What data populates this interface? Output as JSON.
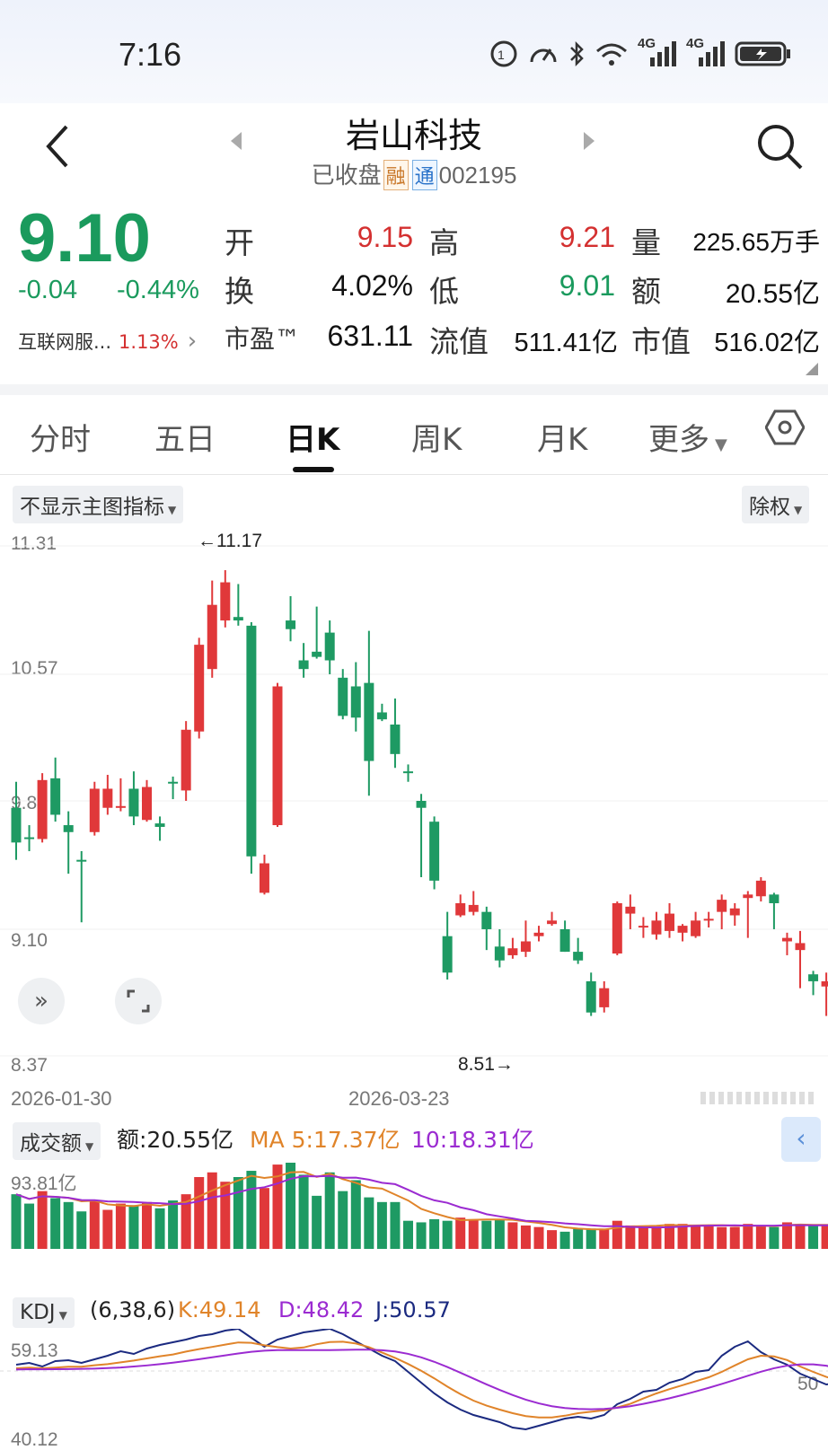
{
  "status_bar": {
    "time": "7:16",
    "icons": [
      "notification-icon",
      "speed-icon",
      "bluetooth-icon",
      "wifi-icon",
      "signal-4g-icon",
      "signal-4g-icon",
      "battery-icon"
    ],
    "net1": "4G",
    "net2": "4G"
  },
  "header": {
    "title": "岩山科技",
    "status": "已收盘",
    "badge1": "融",
    "badge2": "通",
    "code": "002195"
  },
  "quote": {
    "price": "9.10",
    "change": "-0.04",
    "change_pct": "-0.44%",
    "sector_name": "互联网服...",
    "sector_pct": "1.13%",
    "open_label": "开",
    "open": "9.15",
    "high_label": "高",
    "high": "9.21",
    "volume_label": "量",
    "volume": "225.65万手",
    "turnover_label": "换",
    "turnover": "4.02%",
    "low_label": "低",
    "low": "9.01",
    "amount_label": "额",
    "amount": "20.55亿",
    "pe_label": "市盈™",
    "pe": "631.11",
    "float_label": "流值",
    "float_cap": "511.41亿",
    "mcap_label": "市值",
    "mcap": "516.02亿"
  },
  "tabs": [
    "分时",
    "五日",
    "日K",
    "周K",
    "月K",
    "更多"
  ],
  "active_tab": "日K",
  "chart": {
    "indicator_label": "不显示主图指标",
    "adjust_label": "除权",
    "y_labels": [
      "11.31",
      "10.57",
      "9.84",
      "9.10",
      "8.37"
    ],
    "max_marker": "←11.17",
    "min_marker": "8.51→",
    "date_start": "2026-01-30",
    "date_mid": "2026-03-23",
    "up_color": "#e0383a",
    "down_color": "#1e9a63"
  },
  "volume": {
    "label": "成交额",
    "amount": "额:20.55亿",
    "ma5": "MA 5:17.37亿",
    "ma10": "10:18.31亿",
    "max_label": "93.81亿"
  },
  "kdj": {
    "label": "KDJ",
    "params": "(6,38,6)",
    "k": "K:49.14",
    "d": "D:48.42",
    "j": "J:50.57",
    "top": "59.13",
    "bottom": "40.12",
    "right": "50"
  },
  "chart_data": {
    "type": "candlestick",
    "x_range": [
      "2026-01-30",
      "2026-05-?"
    ],
    "ylim": [
      8.37,
      11.31
    ],
    "candles": [
      [
        9.8,
        9.6,
        9.95,
        9.5
      ],
      [
        9.63,
        9.62,
        9.7,
        9.55
      ],
      [
        9.62,
        9.96,
        10.0,
        9.6
      ],
      [
        9.97,
        9.76,
        10.09,
        9.72
      ],
      [
        9.7,
        9.66,
        9.78,
        9.42
      ],
      [
        9.5,
        9.49,
        9.55,
        9.14
      ],
      [
        9.66,
        9.91,
        9.95,
        9.64
      ],
      [
        9.8,
        9.91,
        9.99,
        9.76
      ],
      [
        9.8,
        9.81,
        9.97,
        9.78
      ],
      [
        9.91,
        9.75,
        10.01,
        9.7
      ],
      [
        9.73,
        9.92,
        9.96,
        9.72
      ],
      [
        9.71,
        9.69,
        9.75,
        9.61
      ],
      [
        9.95,
        9.94,
        9.98,
        9.85
      ],
      [
        9.9,
        10.25,
        10.3,
        9.84
      ],
      [
        10.24,
        10.74,
        10.78,
        10.2
      ],
      [
        10.6,
        10.97,
        11.11,
        10.55
      ],
      [
        10.88,
        11.1,
        11.17,
        10.84
      ],
      [
        10.9,
        10.88,
        11.09,
        10.85
      ],
      [
        10.85,
        9.52,
        10.87,
        9.42
      ],
      [
        9.31,
        9.48,
        9.53,
        9.3
      ],
      [
        9.7,
        10.5,
        10.52,
        9.69
      ],
      [
        10.88,
        10.83,
        11.02,
        10.76
      ],
      [
        10.65,
        10.6,
        10.75,
        10.55
      ],
      [
        10.7,
        10.67,
        10.96,
        10.66
      ],
      [
        10.81,
        10.65,
        10.88,
        10.57
      ],
      [
        10.55,
        10.33,
        10.6,
        10.31
      ],
      [
        10.5,
        10.32,
        10.64,
        10.24
      ],
      [
        10.52,
        10.07,
        10.82,
        9.87
      ],
      [
        10.35,
        10.31,
        10.4,
        10.3
      ],
      [
        10.28,
        10.11,
        10.43,
        10.03
      ],
      [
        10.01,
        10.0,
        10.05,
        9.95
      ],
      [
        9.84,
        9.8,
        9.88,
        9.4
      ],
      [
        9.72,
        9.38,
        9.75,
        9.33
      ],
      [
        9.06,
        8.85,
        9.2,
        8.81
      ],
      [
        9.18,
        9.25,
        9.3,
        9.17
      ],
      [
        9.2,
        9.24,
        9.32,
        9.18
      ],
      [
        9.2,
        9.1,
        9.23,
        8.98
      ],
      [
        9.0,
        8.92,
        9.1,
        8.88
      ],
      [
        8.95,
        8.99,
        9.05,
        8.93
      ],
      [
        8.97,
        9.03,
        9.15,
        8.94
      ],
      [
        9.06,
        9.08,
        9.12,
        9.03
      ],
      [
        9.13,
        9.15,
        9.2,
        9.12
      ],
      [
        9.1,
        8.97,
        9.15,
        8.97
      ],
      [
        8.97,
        8.92,
        9.05,
        8.9
      ],
      [
        8.8,
        8.62,
        8.85,
        8.6
      ],
      [
        8.65,
        8.76,
        8.8,
        8.62
      ],
      [
        8.96,
        9.25,
        9.26,
        8.95
      ],
      [
        9.19,
        9.23,
        9.3,
        9.1
      ],
      [
        9.11,
        9.12,
        9.17,
        9.05
      ],
      [
        9.07,
        9.15,
        9.2,
        9.04
      ],
      [
        9.09,
        9.19,
        9.25,
        9.05
      ],
      [
        9.08,
        9.12,
        9.13,
        9.03
      ],
      [
        9.06,
        9.15,
        9.2,
        9.05
      ],
      [
        9.15,
        9.16,
        9.2,
        9.11
      ],
      [
        9.2,
        9.27,
        9.3,
        9.1
      ],
      [
        9.18,
        9.22,
        9.25,
        9.12
      ],
      [
        9.28,
        9.3,
        9.32,
        9.05
      ],
      [
        9.29,
        9.38,
        9.4,
        9.26
      ],
      [
        9.3,
        9.25,
        9.31,
        9.1
      ],
      [
        9.03,
        9.05,
        9.08,
        8.95
      ],
      [
        8.98,
        9.02,
        9.09,
        8.76
      ],
      [
        8.84,
        8.8,
        8.86,
        8.72
      ],
      [
        8.77,
        8.8,
        8.85,
        8.6
      ],
      [
        8.75,
        8.71,
        8.8,
        8.58
      ],
      [
        8.77,
        8.89,
        8.95,
        8.7
      ],
      [
        8.94,
        9.21,
        9.25,
        8.93
      ],
      [
        9.14,
        9.17,
        9.26,
        9.07
      ]
    ]
  }
}
